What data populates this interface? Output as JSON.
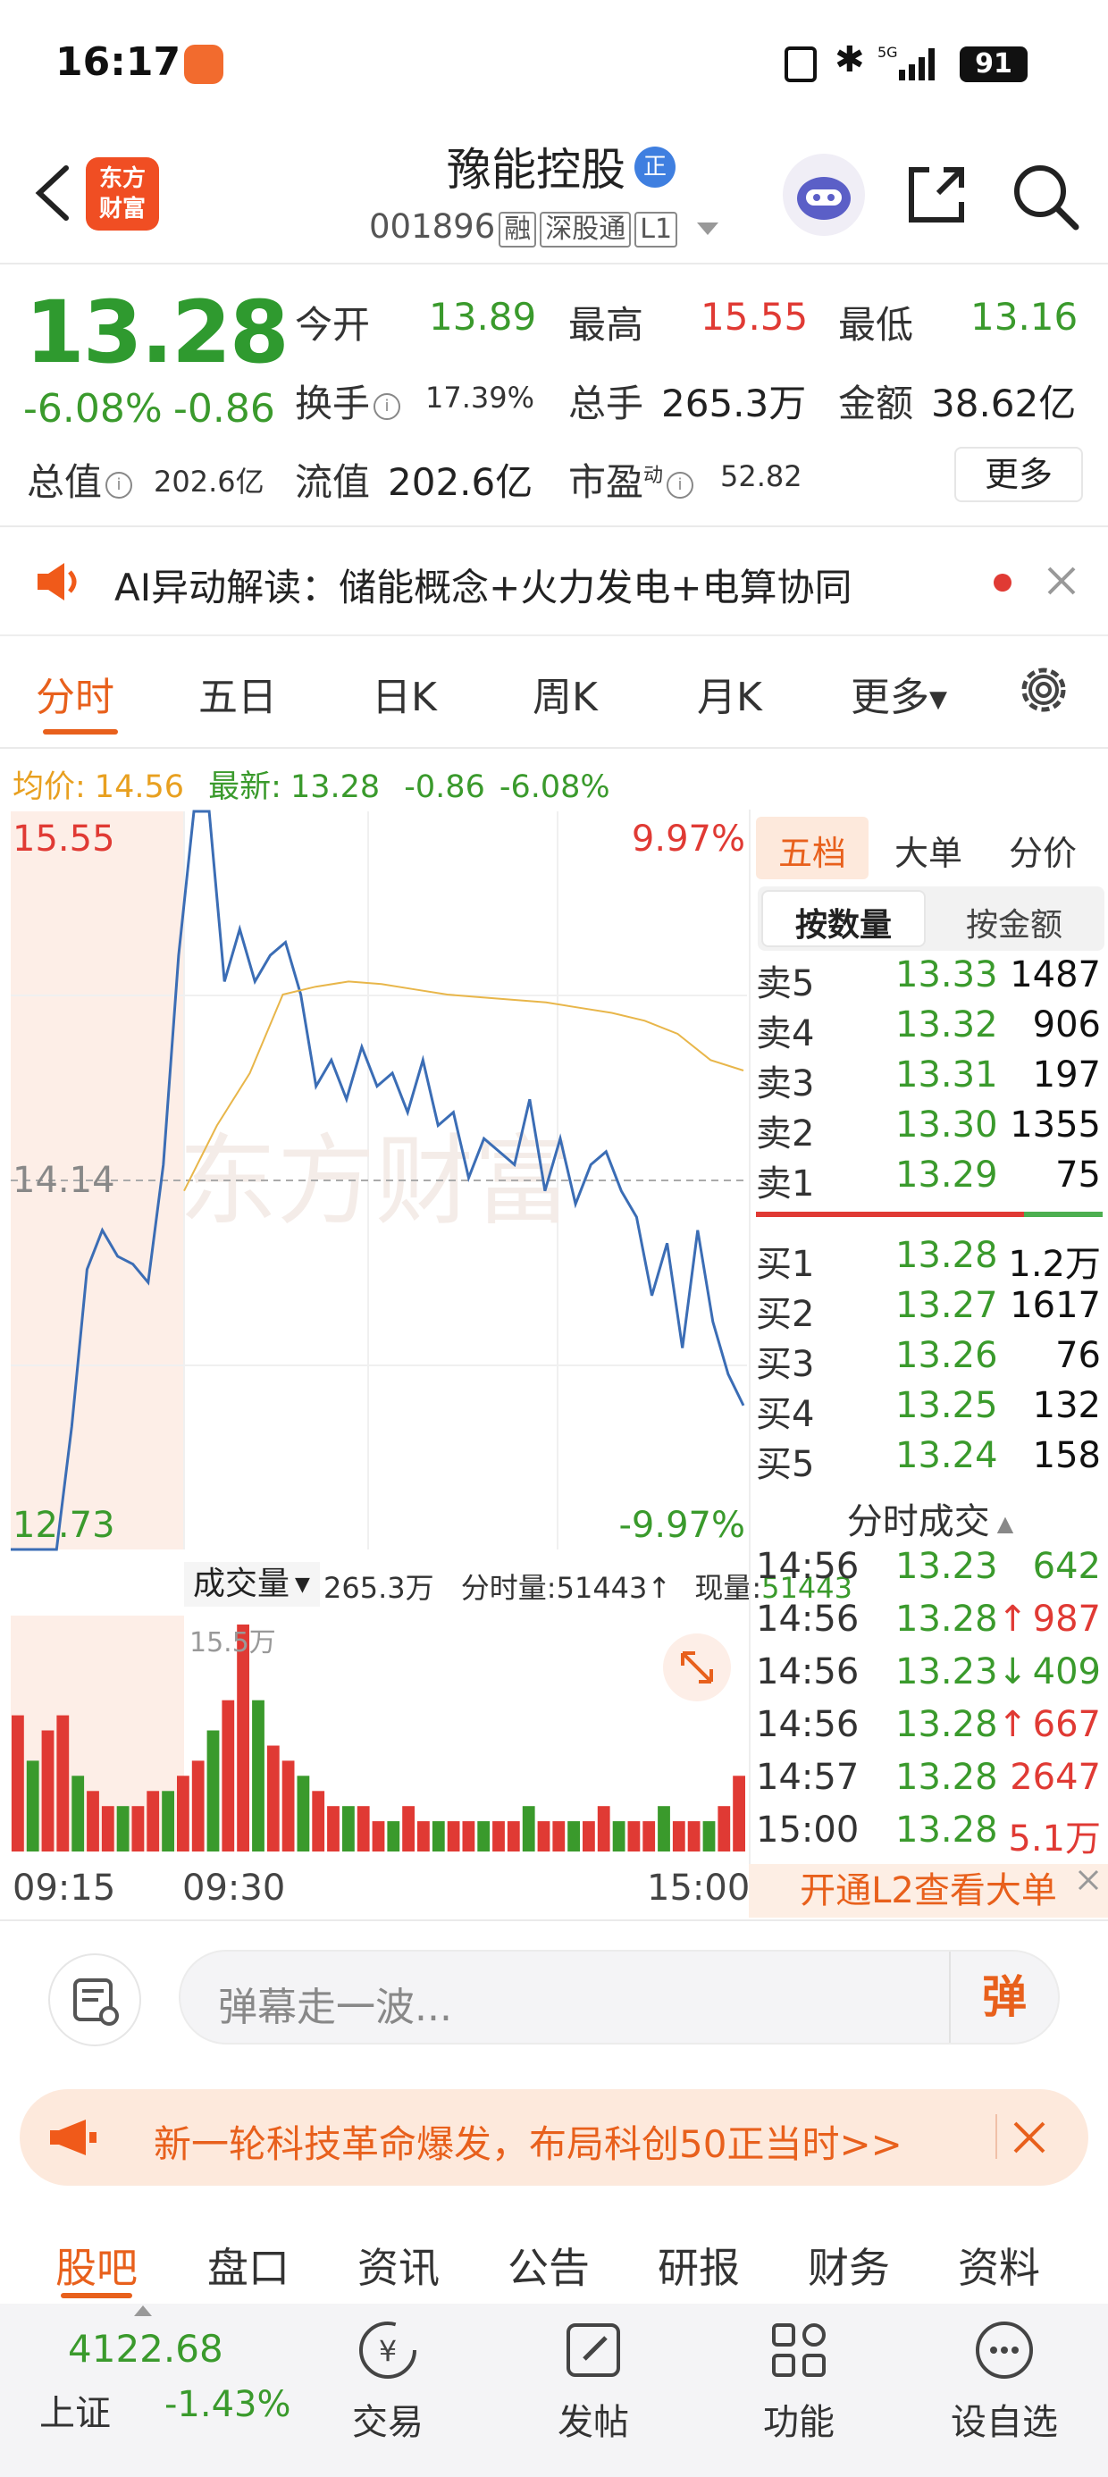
{
  "status_bar": {
    "time": "16:17",
    "battery": "91"
  },
  "header": {
    "logo_line1": "东方",
    "logo_line2": "财富",
    "stock_name": "豫能控股",
    "badge": "正",
    "code": "001896",
    "tags": [
      "融",
      "深股通",
      "L1"
    ]
  },
  "quote": {
    "price": "13.28",
    "change_pct": "-6.08%",
    "change": "-0.86",
    "open_label": "今开",
    "open": "13.89",
    "high_label": "最高",
    "high": "15.55",
    "low_label": "最低",
    "low": "13.16",
    "turnover_label": "换手",
    "turnover": "17.39%",
    "volume_label": "总手",
    "volume": "265.3万",
    "amount_label": "金额",
    "amount": "38.62亿",
    "mktcap_label": "总值",
    "mktcap": "202.6亿",
    "float_label": "流值",
    "float_cap": "202.6亿",
    "pe_label": "市盈",
    "pe_sup": "动",
    "pe": "52.82",
    "more": "更多"
  },
  "ai_bar": {
    "text": "AI异动解读：储能概念+火力发电+电算协同"
  },
  "chart_tabs": [
    "分时",
    "五日",
    "日K",
    "周K",
    "月K",
    "更多"
  ],
  "avg_row": {
    "avg_label": "均价:",
    "avg": "14.56",
    "latest_label": "最新:",
    "latest": "13.28",
    "chg": "-0.86",
    "pct": "-6.08%"
  },
  "chart_data": {
    "type": "line",
    "title": "",
    "y_max_label": "15.55",
    "y_mid_label": "14.14",
    "y_min_label": "12.73",
    "pct_max_label": "9.97%",
    "pct_min_label": "-9.97%",
    "ylim": [
      12.73,
      15.55
    ],
    "prev_close": 14.14,
    "x_labels": [
      "09:15",
      "09:30",
      "15:00"
    ],
    "watermark": "东方财富",
    "series": [
      {
        "values": [
          12.73,
          12.73,
          12.73,
          12.73,
          13.2,
          13.8,
          13.95,
          13.85,
          13.82,
          13.75,
          14.2,
          15.0,
          15.55,
          15.55,
          14.9,
          15.1,
          14.9,
          15.0,
          15.05,
          14.85,
          14.5,
          14.6,
          14.45,
          14.65,
          14.5,
          14.55,
          14.4,
          14.6,
          14.35,
          14.4,
          14.15,
          14.3,
          14.25,
          14.2,
          14.45,
          14.1,
          14.3,
          14.05,
          14.2,
          14.25,
          14.1,
          14.0,
          13.7,
          13.9,
          13.5,
          13.95,
          13.6,
          13.4,
          13.28
        ]
      },
      {
        "values": [
          14.1,
          14.35,
          14.55,
          14.85,
          14.88,
          14.9,
          14.89,
          14.87,
          14.85,
          14.84,
          14.83,
          14.82,
          14.8,
          14.78,
          14.75,
          14.7,
          14.6,
          14.56
        ]
      }
    ],
    "volume": {
      "label": "成交量",
      "total": "265.3万",
      "minute_label": "分时量:",
      "minute": "51443",
      "now_label": "现量:",
      "now": "51443",
      "scale": "15.5万",
      "bars": [
        9,
        6,
        8,
        9,
        5,
        4,
        3,
        3,
        3,
        4,
        4,
        5,
        6,
        8,
        10,
        15,
        10,
        7,
        6,
        5,
        4,
        3,
        3,
        3,
        2,
        2,
        3,
        2,
        2,
        2,
        2,
        2,
        2,
        2,
        3,
        2,
        2,
        2,
        2,
        3,
        2,
        2,
        2,
        3,
        2,
        2,
        2,
        3,
        5
      ]
    }
  },
  "order_book": {
    "tabs": [
      "五档",
      "大单",
      "分价"
    ],
    "seg": [
      "按数量",
      "按金额"
    ],
    "asks": [
      {
        "label": "卖5",
        "price": "13.33",
        "vol": "1487"
      },
      {
        "label": "卖4",
        "price": "13.32",
        "vol": "906"
      },
      {
        "label": "卖3",
        "price": "13.31",
        "vol": "197"
      },
      {
        "label": "卖2",
        "price": "13.30",
        "vol": "1355"
      },
      {
        "label": "卖1",
        "price": "13.29",
        "vol": "75"
      }
    ],
    "bids": [
      {
        "label": "买1",
        "price": "13.28",
        "vol": "1.2万"
      },
      {
        "label": "买2",
        "price": "13.27",
        "vol": "1617"
      },
      {
        "label": "买3",
        "price": "13.26",
        "vol": "76"
      },
      {
        "label": "买4",
        "price": "13.25",
        "vol": "132"
      },
      {
        "label": "买5",
        "price": "13.24",
        "vol": "158"
      }
    ]
  },
  "ticks": {
    "title": "分时成交",
    "rows": [
      {
        "time": "14:56",
        "price": "13.23",
        "vol": "642",
        "dir": ""
      },
      {
        "time": "14:56",
        "price": "13.28",
        "vol": "987",
        "dir": "↑"
      },
      {
        "time": "14:56",
        "price": "13.23",
        "vol": "409",
        "dir": "↓"
      },
      {
        "time": "14:56",
        "price": "13.28",
        "vol": "667",
        "dir": "↑"
      },
      {
        "time": "14:57",
        "price": "13.28",
        "vol": "2647",
        "dir": ""
      },
      {
        "time": "15:00",
        "price": "13.28",
        "vol": "5.1万",
        "dir": ""
      }
    ],
    "l2_banner": "开通L2查看大单"
  },
  "comment": {
    "placeholder": "弹幕走一波...",
    "danmu": "弹"
  },
  "promo": {
    "text": "新一轮科技革命爆发，布局科创50正当时>>"
  },
  "bottom_tabs": [
    "股吧",
    "盘口",
    "资讯",
    "公告",
    "研报",
    "财务",
    "资料"
  ],
  "toolbar": {
    "index_value": "4122.68",
    "index_name": "上证",
    "index_change": "-1.43%",
    "items": [
      "交易",
      "发帖",
      "功能",
      "设自选"
    ]
  },
  "colors": {
    "up": "#e03a34",
    "down": "#3a9a2c",
    "accent": "#e8601c",
    "price_line": "#3b6db5",
    "avg_line": "#e8b64a"
  }
}
